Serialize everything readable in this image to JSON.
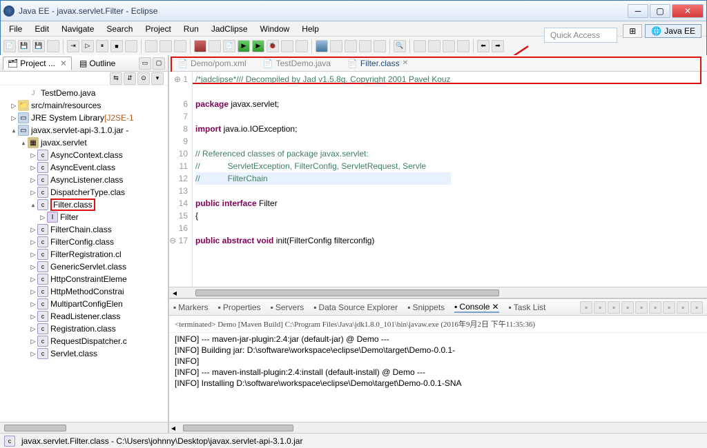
{
  "window": {
    "title": "Java EE - javax.servlet.Filter - Eclipse"
  },
  "menu": [
    "File",
    "Edit",
    "Navigate",
    "Search",
    "Project",
    "Run",
    "JadClipse",
    "Window",
    "Help"
  ],
  "quick_access": "Quick Access",
  "perspective": "Java EE",
  "left": {
    "tabs": {
      "project": "Project ...",
      "outline": "Outline"
    },
    "tree": [
      {
        "d": 2,
        "tw": "",
        "ic": "ju",
        "label": "TestDemo.java"
      },
      {
        "d": 1,
        "tw": "▷",
        "ic": "fold",
        "label": "src/main/resources"
      },
      {
        "d": 1,
        "tw": "▷",
        "ic": "jar",
        "label": "JRE System Library",
        "extra": "[J2SE-1"
      },
      {
        "d": 1,
        "tw": "▴",
        "ic": "jar",
        "label": "javax.servlet-api-3.1.0.jar -"
      },
      {
        "d": 2,
        "tw": "▴",
        "ic": "pkg",
        "label": "javax.servlet"
      },
      {
        "d": 3,
        "tw": "▷",
        "ic": "cls",
        "label": "AsyncContext.class"
      },
      {
        "d": 3,
        "tw": "▷",
        "ic": "cls",
        "label": "AsyncEvent.class"
      },
      {
        "d": 3,
        "tw": "▷",
        "ic": "cls",
        "label": "AsyncListener.class"
      },
      {
        "d": 3,
        "tw": "▷",
        "ic": "cls",
        "label": "DispatcherType.clas"
      },
      {
        "d": 3,
        "tw": "▴",
        "ic": "cls",
        "label": "Filter.class",
        "sel": true
      },
      {
        "d": 4,
        "tw": "▷",
        "ic": "intf",
        "label": "Filter"
      },
      {
        "d": 3,
        "tw": "▷",
        "ic": "cls",
        "label": "FilterChain.class"
      },
      {
        "d": 3,
        "tw": "▷",
        "ic": "cls",
        "label": "FilterConfig.class"
      },
      {
        "d": 3,
        "tw": "▷",
        "ic": "cls",
        "label": "FilterRegistration.cl"
      },
      {
        "d": 3,
        "tw": "▷",
        "ic": "cls",
        "label": "GenericServlet.class"
      },
      {
        "d": 3,
        "tw": "▷",
        "ic": "cls",
        "label": "HttpConstraintEleme"
      },
      {
        "d": 3,
        "tw": "▷",
        "ic": "cls",
        "label": "HttpMethodConstrai"
      },
      {
        "d": 3,
        "tw": "▷",
        "ic": "cls",
        "label": "MultipartConfigElen"
      },
      {
        "d": 3,
        "tw": "▷",
        "ic": "cls",
        "label": "ReadListener.class"
      },
      {
        "d": 3,
        "tw": "▷",
        "ic": "cls",
        "label": "Registration.class"
      },
      {
        "d": 3,
        "tw": "▷",
        "ic": "cls",
        "label": "RequestDispatcher.c"
      },
      {
        "d": 3,
        "tw": "▷",
        "ic": "cls",
        "label": "Servlet.class"
      }
    ]
  },
  "editor": {
    "tabs": [
      {
        "label": "Demo/pom.xml",
        "active": false
      },
      {
        "label": "TestDemo.java",
        "active": false
      },
      {
        "label": "Filter.class",
        "active": true
      }
    ],
    "lines": [
      {
        "n": "1",
        "cls": "cm",
        "t": "/*jadclipse*/// Decompiled by Jad v1.5.8g. Copyright 2001 Pavel Kouz",
        "fold": "⊕"
      },
      {
        "n": "",
        "t": ""
      },
      {
        "n": "6",
        "t": "package javax.servlet;",
        "kw": "package"
      },
      {
        "n": "7",
        "t": ""
      },
      {
        "n": "8",
        "t": "import java.io.IOException;",
        "kw": "import"
      },
      {
        "n": "9",
        "t": ""
      },
      {
        "n": "10",
        "cls": "cm",
        "t": "// Referenced classes of package javax.servlet:"
      },
      {
        "n": "11",
        "cls": "cm",
        "t": "//            ServletException, FilterConfig, ServletRequest, Servle"
      },
      {
        "n": "12",
        "cls": "cm hl",
        "t": "//            FilterChain"
      },
      {
        "n": "13",
        "t": ""
      },
      {
        "n": "14",
        "t": "public interface Filter",
        "kw": "public interface"
      },
      {
        "n": "15",
        "t": "{"
      },
      {
        "n": "16",
        "t": ""
      },
      {
        "n": "17",
        "t": "    public abstract void init(FilterConfig filterconfig)",
        "kw": "public abstract void",
        "fold": "⊖"
      }
    ]
  },
  "bottom": {
    "tabs": [
      "Markers",
      "Properties",
      "Servers",
      "Data Source Explorer",
      "Snippets",
      "Console",
      "Task List"
    ],
    "active": 5,
    "head": "<terminated> Demo [Maven Build] C:\\Program Files\\Java\\jdk1.8.0_101\\bin\\javaw.exe (2016年9月2日 下午11:35:36)",
    "lines": [
      "[INFO] --- maven-jar-plugin:2.4:jar (default-jar) @ Demo ---",
      "[INFO] Building jar: D:\\software\\workspace\\eclipse\\Demo\\target\\Demo-0.0.1-",
      "[INFO] ",
      "[INFO] --- maven-install-plugin:2.4:install (default-install) @ Demo ---",
      "[INFO] Installing D:\\software\\workspace\\eclipse\\Demo\\target\\Demo-0.0.1-SNA"
    ]
  },
  "status": "javax.servlet.Filter.class - C:\\Users\\johnny\\Desktop\\javax.servlet-api-3.1.0.jar"
}
